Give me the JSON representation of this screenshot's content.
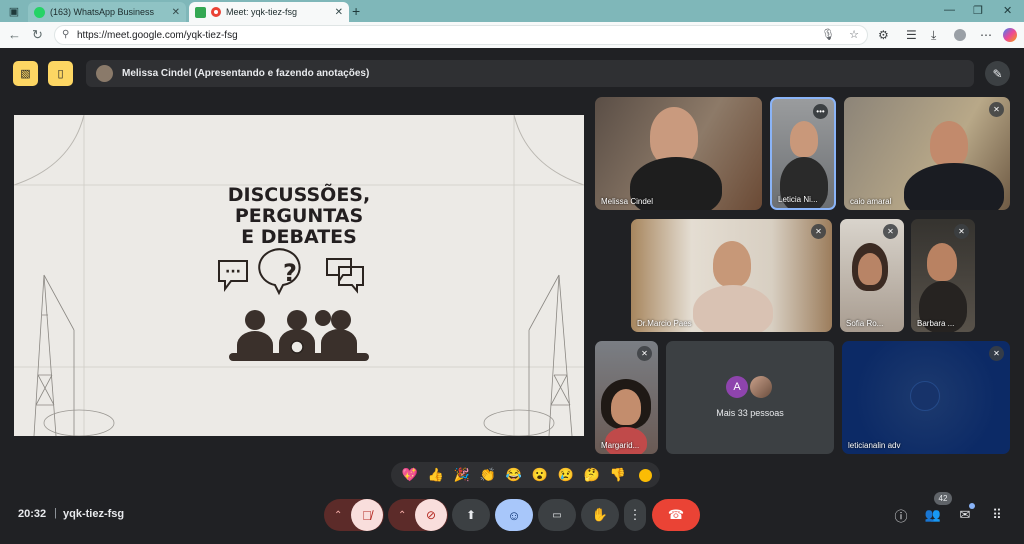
{
  "browser": {
    "tabs": [
      {
        "title": "(163) WhatsApp Business",
        "favicon_color": "#25d366",
        "active": false
      },
      {
        "title": "Meet: yqk-tiez-fsg",
        "favicon_color": "#ea4335",
        "active": true
      }
    ],
    "new_tab": "+",
    "url": "https://meet.google.com/yqk-tiez-fsg",
    "window_controls": [
      "—",
      "❐",
      "✕"
    ]
  },
  "meet": {
    "presenter_text": "Melissa Cindel (Apresentando e fazendo anotações)",
    "slide_title_lines": [
      "DISCUSSÕES,",
      "PERGUNTAS",
      "E DEBATES"
    ],
    "participants": [
      {
        "name": "Melissa Cindel",
        "muted": false
      },
      {
        "name": "Leticia Ni...",
        "muted": false,
        "has_menu": true
      },
      {
        "name": "caio amaral",
        "muted": true
      },
      {
        "name": "Dr.Marcio Paes",
        "muted": true
      },
      {
        "name": "Sofia Ro...",
        "muted": true
      },
      {
        "name": "Barbara ...",
        "muted": true
      },
      {
        "name": "Margarid...",
        "muted": true
      },
      {
        "name": "leticianalin adv",
        "muted": true
      }
    ],
    "more_people": {
      "label": "Mais 33 pessoas",
      "avatar_letter": "A"
    },
    "reactions": [
      "💖",
      "👍",
      "🎉",
      "👏",
      "😂",
      "😮",
      "😢",
      "🤔",
      "👎"
    ],
    "clock": "20:32",
    "meeting_code": "yqk-tiez-fsg",
    "participant_count": "42",
    "colors": {
      "accent_yellow": "#fdd663",
      "hangup_red": "#ea4335",
      "reactions_blue": "#a8c7fa",
      "background": "#202124"
    }
  }
}
